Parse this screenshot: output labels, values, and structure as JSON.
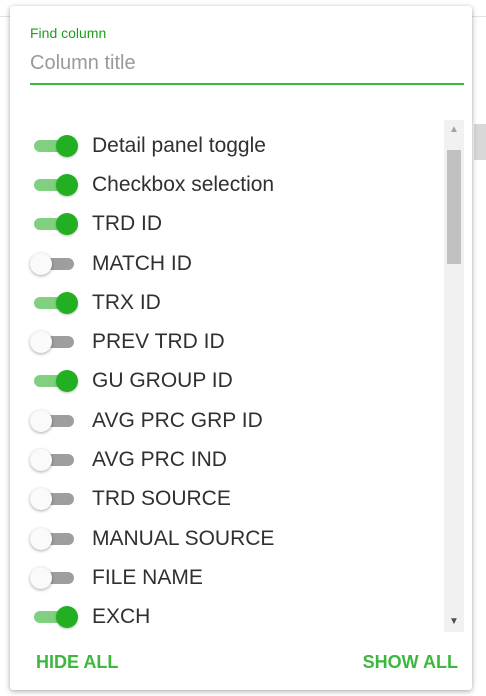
{
  "search": {
    "label": "Find column",
    "placeholder": "Column title",
    "value": ""
  },
  "columns": [
    {
      "label": "Detail panel toggle",
      "visible": true
    },
    {
      "label": "Checkbox selection",
      "visible": true
    },
    {
      "label": "TRD ID",
      "visible": true
    },
    {
      "label": "MATCH ID",
      "visible": false
    },
    {
      "label": "TRX ID",
      "visible": true
    },
    {
      "label": "PREV TRD ID",
      "visible": false
    },
    {
      "label": "GU GROUP ID",
      "visible": true
    },
    {
      "label": "AVG PRC GRP ID",
      "visible": false
    },
    {
      "label": "AVG PRC IND",
      "visible": false
    },
    {
      "label": "TRD SOURCE",
      "visible": false
    },
    {
      "label": "MANUAL SOURCE",
      "visible": false
    },
    {
      "label": "FILE NAME",
      "visible": false
    },
    {
      "label": "EXCH",
      "visible": true
    }
  ],
  "footer": {
    "hide_all": "HIDE ALL",
    "show_all": "SHOW ALL"
  },
  "colors": {
    "accent": "#3cb83c",
    "switch_on_thumb": "#22b022",
    "switch_on_track": "#7fd17f",
    "switch_off_track": "#9e9e9e"
  },
  "icons": {
    "scroll_up": "triangle-up",
    "scroll_down": "triangle-down"
  }
}
